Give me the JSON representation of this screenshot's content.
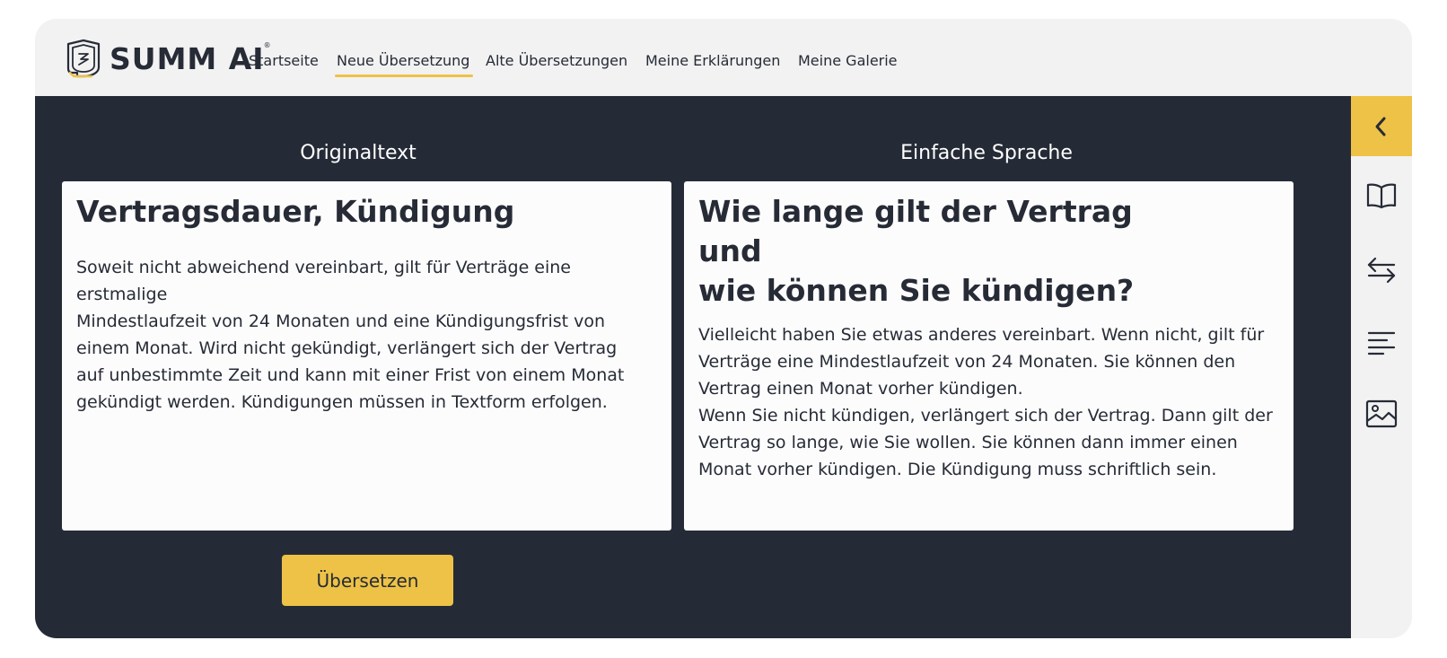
{
  "brand": {
    "name": "SUMM AI",
    "registered_mark": "®"
  },
  "nav": {
    "items": [
      {
        "label": "Startseite",
        "active": false
      },
      {
        "label": "Neue Übersetzung",
        "active": true
      },
      {
        "label": "Alte Übersetzungen",
        "active": false
      },
      {
        "label": "Meine Erklärungen",
        "active": false
      },
      {
        "label": "Meine Galerie",
        "active": false
      }
    ]
  },
  "original": {
    "title": "Originaltext",
    "heading": "Vertragsdauer, Kündigung",
    "body": "Soweit nicht abweichend vereinbart, gilt für Verträge eine erstmalige\nMindestlaufzeit von 24 Monaten und eine Kündigungsfrist von\neinem Monat. Wird nicht gekündigt, verlängert sich der Vertrag\nauf unbestimmte Zeit und kann mit einer Frist von einem Monat\ngekündigt werden. Kündigungen müssen in Textform erfolgen."
  },
  "simple": {
    "title": "Einfache Sprache",
    "heading": "Wie lange gilt der Vertrag und\nwie können Sie kündigen?",
    "body": "Vielleicht haben Sie etwas anderes vereinbart. Wenn nicht, gilt für\nVerträge eine Mindestlaufzeit von 24 Monaten. Sie können den\nVertrag einen Monat vorher kündigen.\nWenn Sie nicht kündigen, verlängert sich der Vertrag. Dann gilt der\nVertrag so lange, wie Sie wollen. Sie können dann immer einen\nMonat vorher kündigen. Die Kündigung muss schriftlich sein."
  },
  "actions": {
    "translate_label": "Übersetzen"
  },
  "sidebar": {
    "icons": [
      "chevron-left-icon",
      "book-icon",
      "swap-arrows-icon",
      "align-left-icon",
      "image-icon"
    ]
  },
  "colors": {
    "accent": "#edc246",
    "dark": "#252b36",
    "light": "#f2f2f2",
    "panel": "#fcfcfc"
  }
}
